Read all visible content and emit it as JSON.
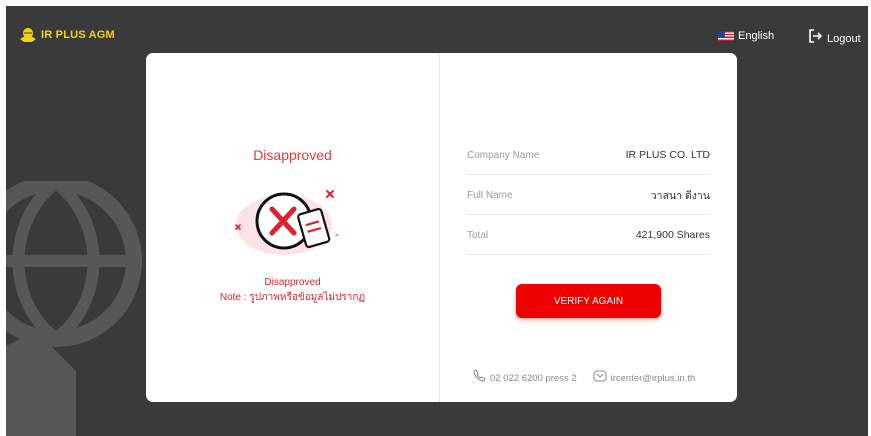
{
  "header": {
    "logo_text": "IR PLUS AGM",
    "logo_icon": "handshake-icon",
    "language_label": "English",
    "language_flag": "us-flag-icon",
    "logout_label": "Logout"
  },
  "status_panel": {
    "title": "Disapproved",
    "illustration": "rejected-document-icon",
    "status_label": "Disapproved",
    "note": "Note : รูปภาพหรือข้อมูลไม่ปรากฏ"
  },
  "info": {
    "rows": [
      {
        "label": "Company Name",
        "value": "IR PLUS CO. LTD"
      },
      {
        "label": "Full Name",
        "value": "วาสนา ดีงาน"
      },
      {
        "label": "Total",
        "value": "421,900 Shares"
      }
    ]
  },
  "actions": {
    "verify_label": "VERIFY AGAIN"
  },
  "contact": {
    "phone": "02 022 6200 press 2",
    "email": "ircenter@irplus.in.th"
  },
  "colors": {
    "background": "#3a3a3a",
    "brand_yellow": "#f2d20f",
    "accent_red": "#ee0000",
    "card": "#ffffff"
  }
}
